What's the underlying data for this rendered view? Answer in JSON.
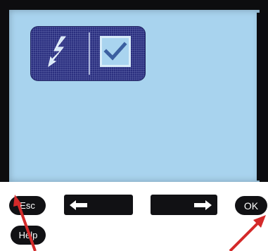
{
  "device": {
    "screen_color": "#a8d3ee",
    "panel_color": "#2b2f7f",
    "bezel_color": "#0d0d0f"
  },
  "status_panel": {
    "left_icon": "lightning-bolt-icon",
    "right_icon": "checkbox-checked-icon"
  },
  "soft_keys": {
    "esc_label": "Esc",
    "ok_label": "OK",
    "help_label": "Help",
    "left_icon": "arrow-left-icon",
    "right_icon": "arrow-right-icon"
  },
  "annotations": {
    "color": "#d42a2a"
  }
}
